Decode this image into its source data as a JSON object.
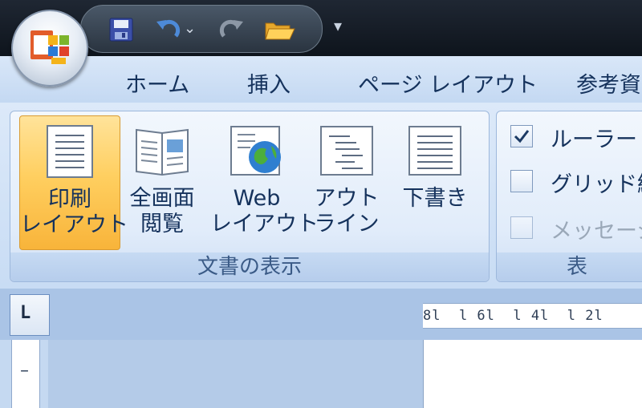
{
  "quick_access": {
    "items": [
      {
        "name": "save",
        "icon": "save-icon"
      },
      {
        "name": "undo",
        "icon": "undo-icon"
      },
      {
        "name": "undo-dropdown",
        "icon": "chevron-down-icon"
      },
      {
        "name": "redo",
        "icon": "redo-icon"
      },
      {
        "name": "open",
        "icon": "folder-open-icon"
      }
    ],
    "customize_glyph": "▾"
  },
  "tabs": [
    {
      "label": "ホーム"
    },
    {
      "label": "挿入"
    },
    {
      "label": "ページ レイアウト"
    },
    {
      "label": "参考資"
    }
  ],
  "document_views_group": {
    "label": "文書の表示",
    "buttons": [
      {
        "label": "印刷\nレイアウト",
        "icon": "print-layout-icon",
        "active": true
      },
      {
        "label": "全画面\n閲覧",
        "icon": "full-screen-reading-icon",
        "active": false
      },
      {
        "label": "Web\nレイアウト",
        "icon": "web-layout-icon",
        "active": false
      },
      {
        "label": "アウト\nライン",
        "icon": "outline-icon",
        "active": false
      },
      {
        "label": "下書き",
        "icon": "draft-icon",
        "active": false
      }
    ]
  },
  "show_group": {
    "label": "表",
    "checkboxes": [
      {
        "label": "ルーラー",
        "checked": true,
        "enabled": true
      },
      {
        "label": "グリッド線",
        "checked": false,
        "enabled": true
      },
      {
        "label": "メッセージ",
        "checked": false,
        "enabled": false
      }
    ]
  },
  "ruler": {
    "text": "8l  l 6l  l 4l  l 2l",
    "tab_selector": "L",
    "vertical_mark": "–"
  },
  "colors": {
    "accent_active": "#f8b43a",
    "title_bar": "#0e141c",
    "ribbon_bg": "#dce9f9",
    "text": "#15325c"
  }
}
